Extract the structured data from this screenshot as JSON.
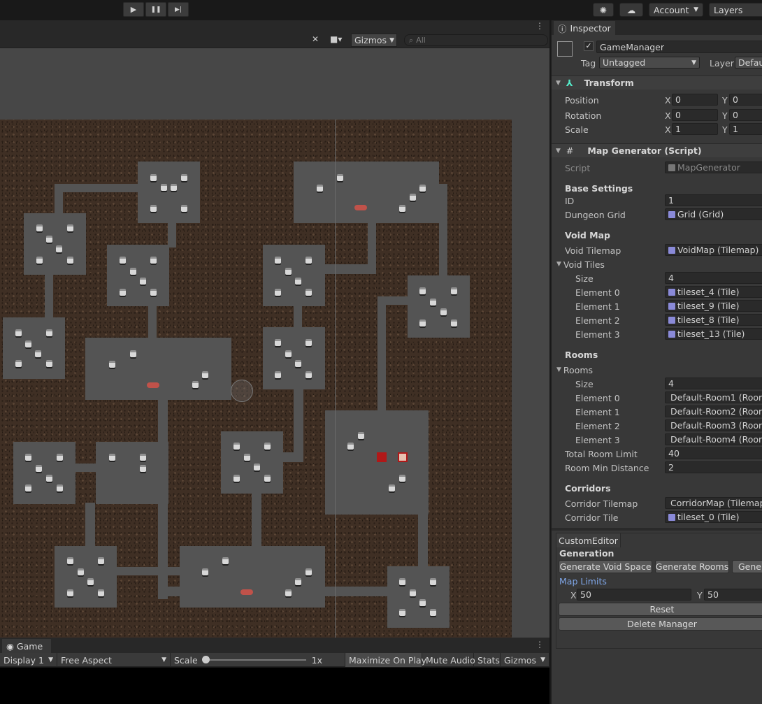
{
  "toolbar": {
    "play_label": "▶",
    "pause_label": "❚❚",
    "step_label": "▶|",
    "account_label": "Account",
    "layers_label": "Layers"
  },
  "scene": {
    "gizmos_label": "Gizmos",
    "search_placeholder": "All"
  },
  "inspector": {
    "tab_label": "Inspector",
    "object_name": "GameManager",
    "tag_label": "Tag",
    "tag_value": "Untagged",
    "layer_label": "Layer",
    "layer_value": "Defaul",
    "transform": {
      "title": "Transform",
      "position_label": "Position",
      "rotation_label": "Rotation",
      "scale_label": "Scale",
      "pos_x": "0",
      "pos_y": "0",
      "rot_x": "0",
      "rot_y": "0",
      "scale_x": "1",
      "scale_y": "1",
      "x_axis": "X",
      "y_axis": "Y"
    },
    "map_generator": {
      "title": "Map Generator (Script)",
      "script_label": "Script",
      "script_value": "MapGenerator",
      "base_settings": "Base Settings",
      "id_label": "ID",
      "id_value": "1",
      "dungeon_grid_label": "Dungeon Grid",
      "dungeon_grid_value": "Grid (Grid)",
      "void_map": "Void Map",
      "void_tilemap_label": "Void Tilemap",
      "void_tilemap_value": "VoidMap (Tilemap)",
      "void_tiles_label": "Void Tiles",
      "size_label": "Size",
      "void_tiles_size": "4",
      "void_tiles": [
        {
          "label": "Element 0",
          "value": "tileset_4 (Tile)"
        },
        {
          "label": "Element 1",
          "value": "tileset_9 (Tile)"
        },
        {
          "label": "Element 2",
          "value": "tileset_8 (Tile)"
        },
        {
          "label": "Element 3",
          "value": "tileset_13 (Tile)"
        }
      ],
      "rooms_header": "Rooms",
      "rooms_label": "Rooms",
      "rooms_size": "4",
      "rooms": [
        {
          "label": "Element 0",
          "value": "Default-Room1 (Room"
        },
        {
          "label": "Element 1",
          "value": "Default-Room2 (Room"
        },
        {
          "label": "Element 2",
          "value": "Default-Room3 (Room"
        },
        {
          "label": "Element 3",
          "value": "Default-Room4 (Room"
        }
      ],
      "total_room_limit_label": "Total Room Limit",
      "total_room_limit_value": "40",
      "room_min_distance_label": "Room Min Distance",
      "room_min_distance_value": "2",
      "corridors_header": "Corridors",
      "corridor_tilemap_label": "Corridor Tilemap",
      "corridor_tilemap_value": "CorridorMap (Tilemap)",
      "corridor_tile_label": "Corridor Tile",
      "corridor_tile_value": "tileset_0 (Tile)"
    },
    "custom_editor": {
      "tab_label": "CustomEditor",
      "generation_label": "Generation",
      "gen_void_label": "Generate Void Space",
      "gen_rooms_label": "Generate Rooms",
      "gen_more_label": "Gener",
      "map_limits_label": "Map Limits",
      "limit_x": "50",
      "limit_y": "50",
      "reset_label": "Reset",
      "delete_label": "Delete Manager"
    }
  },
  "game": {
    "tab_label": "Game",
    "display_label": "Display 1",
    "aspect_label": "Free Aspect",
    "scale_label": "Scale",
    "scale_value": "1x",
    "maximize_label": "Maximize On Play",
    "mute_label": "Mute Audio",
    "stats_label": "Stats",
    "gizmos_label": "Gizmos"
  },
  "colors": {
    "accent_link": "#7fa6e8",
    "room_floor": "#545454",
    "dirt": "#3f2f24",
    "enemy": "#c0524a"
  }
}
